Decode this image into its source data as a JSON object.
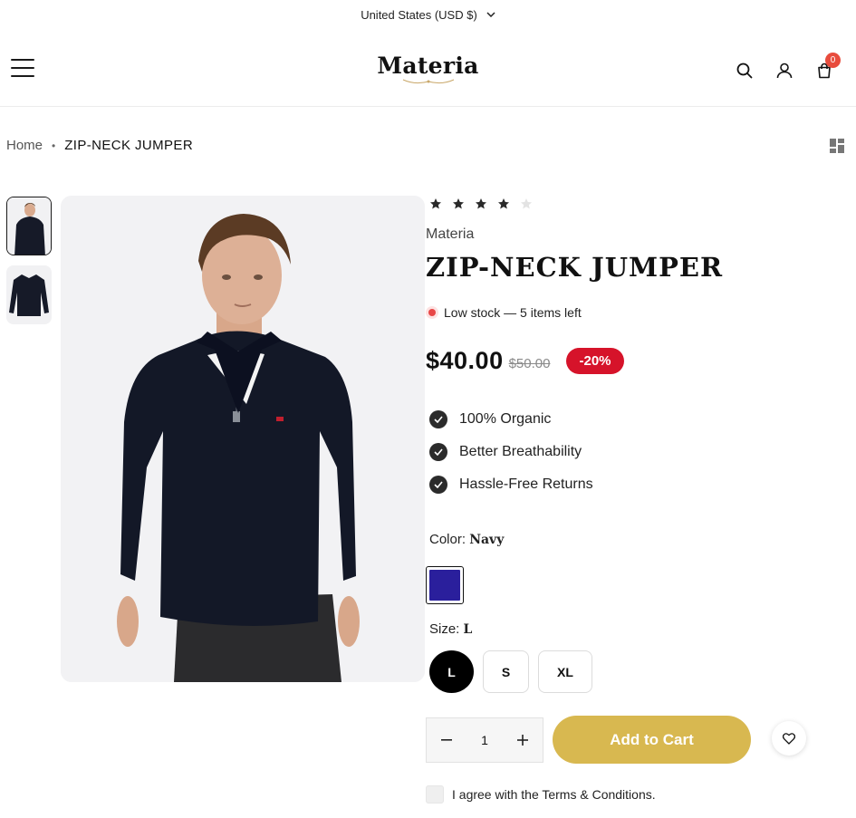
{
  "topbar": {
    "currency": "United States (USD $)"
  },
  "header": {
    "logo": "Materia",
    "cart_count": "0"
  },
  "breadcrumb": {
    "home": "Home",
    "current": "ZIP-NECK JUMPER"
  },
  "product": {
    "rating": 4,
    "rating_max": 5,
    "brand": "Materia",
    "title": "ZIP-NECK JUMPER",
    "stock_text": "Low stock — 5 items left",
    "price": "$40.00",
    "compare_price": "$50.00",
    "discount": "-20%",
    "features": [
      "100% Organic",
      "Better Breathability",
      "Hassle-Free Returns"
    ],
    "color_label": "Color:",
    "color_value": "Navy",
    "swatch_color": "#2a1f9c",
    "size_label": "Size:",
    "size_value": "L",
    "sizes": [
      "L",
      "S",
      "XL"
    ],
    "quantity": "1",
    "add_to_cart": "Add to Cart",
    "agree_text": "I agree with the Terms & Conditions."
  },
  "colors": {
    "accent": "#d8b850",
    "sale": "#d6132a",
    "stock_dot": "#e84747",
    "badge": "#e84c3d"
  }
}
